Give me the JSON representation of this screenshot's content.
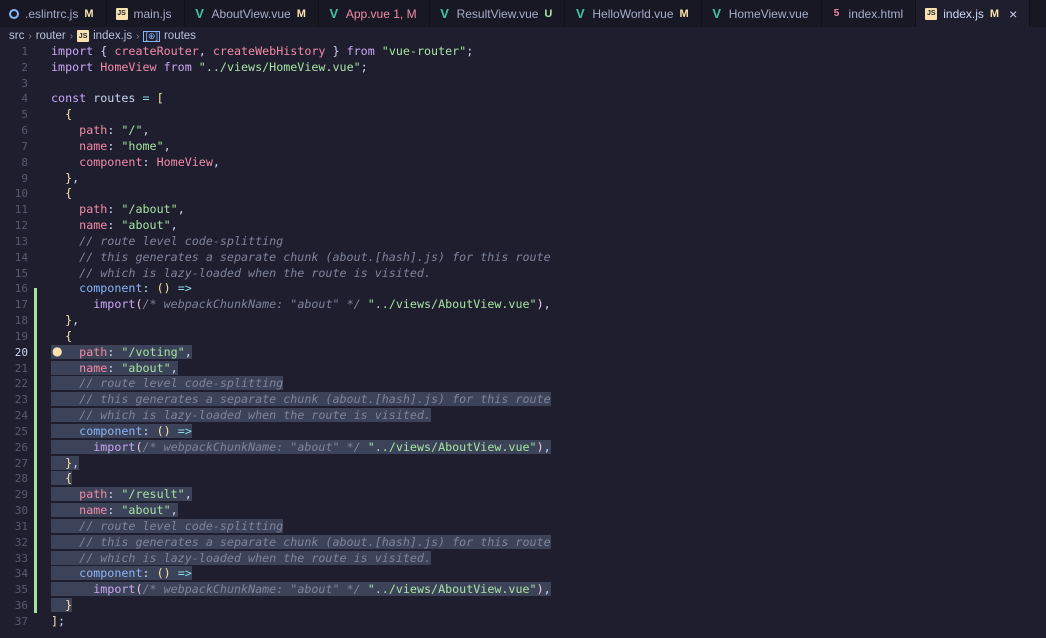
{
  "tabs": [
    {
      "label": ".eslintrc.js",
      "status": "M",
      "icon": "eslint-icon",
      "active": false
    },
    {
      "label": "main.js",
      "status": "",
      "icon": "js-icon",
      "active": false
    },
    {
      "label": "AboutView.vue",
      "status": "M",
      "icon": "vue-icon",
      "active": false
    },
    {
      "label": "App.vue 1, M",
      "status": "",
      "icon": "vue-icon",
      "active": false
    },
    {
      "label": "ResultView.vue",
      "status": "U",
      "icon": "vue-icon",
      "active": false
    },
    {
      "label": "HelloWorld.vue",
      "status": "M",
      "icon": "vue-icon",
      "active": false
    },
    {
      "label": "HomeView.vue",
      "status": "",
      "icon": "vue-icon",
      "active": false
    },
    {
      "label": "index.html",
      "status": "",
      "icon": "html-icon",
      "active": false
    },
    {
      "label": "index.js",
      "status": "M",
      "icon": "js-icon",
      "active": true
    }
  ],
  "breadcrumb": {
    "seg1": "src",
    "seg2": "router",
    "seg3": "index.js",
    "seg4": "routes"
  },
  "icon_glyphs": {
    "js": "JS",
    "vue": "V",
    "close": "×",
    "sym": "[⊕]"
  },
  "colors": {
    "accent_modified": "#f9e2af",
    "accent_untracked": "#a6e3a1",
    "gutter_added": "#a6e3a1"
  },
  "current_line": 20,
  "lines": [
    {
      "n": "1",
      "t": [
        [
          "k",
          "import "
        ],
        [
          "",
          "{ "
        ],
        [
          "p",
          "createRouter"
        ],
        [
          "",
          ", "
        ],
        [
          "p",
          "createWebHistory"
        ],
        [
          "",
          " } "
        ],
        [
          "k",
          "from "
        ],
        [
          "s",
          "\"vue-router\""
        ],
        [
          "",
          ";"
        ]
      ]
    },
    {
      "n": "2",
      "t": [
        [
          "k",
          "import "
        ],
        [
          "p",
          "HomeView "
        ],
        [
          "k",
          "from "
        ],
        [
          "s",
          "\"../views/HomeView.vue\""
        ],
        [
          "",
          ";"
        ]
      ]
    },
    {
      "n": "3",
      "t": []
    },
    {
      "n": "4",
      "t": [
        [
          "k",
          "const "
        ],
        [
          "",
          "routes "
        ],
        [
          "o",
          "= "
        ],
        [
          "b",
          "["
        ]
      ]
    },
    {
      "n": "5",
      "t": [
        [
          "",
          "  "
        ],
        [
          "b",
          "{"
        ]
      ]
    },
    {
      "n": "6",
      "t": [
        [
          "",
          "    "
        ],
        [
          "p",
          "path"
        ],
        [
          "",
          ": "
        ],
        [
          "s",
          "\"/\""
        ],
        [
          "",
          ","
        ]
      ]
    },
    {
      "n": "7",
      "t": [
        [
          "",
          "    "
        ],
        [
          "p",
          "name"
        ],
        [
          "",
          ": "
        ],
        [
          "s",
          "\"home\""
        ],
        [
          "",
          ","
        ]
      ]
    },
    {
      "n": "8",
      "t": [
        [
          "",
          "    "
        ],
        [
          "p",
          "component"
        ],
        [
          "",
          ": "
        ],
        [
          "p",
          "HomeView"
        ],
        [
          "",
          ","
        ]
      ]
    },
    {
      "n": "9",
      "t": [
        [
          "",
          "  "
        ],
        [
          "b",
          "}"
        ],
        [
          "",
          ","
        ]
      ]
    },
    {
      "n": "10",
      "t": [
        [
          "",
          "  "
        ],
        [
          "b",
          "{"
        ]
      ]
    },
    {
      "n": "11",
      "t": [
        [
          "",
          "    "
        ],
        [
          "p",
          "path"
        ],
        [
          "",
          ": "
        ],
        [
          "s",
          "\"/about\""
        ],
        [
          "",
          ","
        ]
      ]
    },
    {
      "n": "12",
      "t": [
        [
          "",
          "    "
        ],
        [
          "p",
          "name"
        ],
        [
          "",
          ": "
        ],
        [
          "s",
          "\"about\""
        ],
        [
          "",
          ","
        ]
      ]
    },
    {
      "n": "13",
      "t": [
        [
          "",
          "    "
        ],
        [
          "c",
          "// route level code-splitting"
        ]
      ]
    },
    {
      "n": "14",
      "t": [
        [
          "",
          "    "
        ],
        [
          "c",
          "// this generates a separate chunk (about.[hash].js) for this route"
        ]
      ]
    },
    {
      "n": "15",
      "t": [
        [
          "",
          "    "
        ],
        [
          "c",
          "// which is lazy-loaded when the route is visited."
        ]
      ]
    },
    {
      "n": "16",
      "t": [
        [
          "",
          "    "
        ],
        [
          "fn",
          "component"
        ],
        [
          "",
          ": "
        ],
        [
          "b",
          "()"
        ],
        [
          "",
          " "
        ],
        [
          "o",
          "=>"
        ]
      ]
    },
    {
      "n": "17",
      "t": [
        [
          "",
          "      "
        ],
        [
          "k",
          "import"
        ],
        [
          "f",
          "("
        ],
        [
          "c",
          "/* webpackChunkName: \"about\" */"
        ],
        [
          "",
          " "
        ],
        [
          "s",
          "\"../views/AboutView.vue\""
        ],
        [
          "f",
          ")"
        ],
        [
          "",
          ","
        ]
      ]
    },
    {
      "n": "18",
      "t": [
        [
          "",
          "  "
        ],
        [
          "b",
          "}"
        ],
        [
          "",
          ","
        ]
      ]
    },
    {
      "n": "19",
      "t": [
        [
          "",
          "  "
        ],
        [
          "b",
          "{"
        ]
      ]
    },
    {
      "n": "20",
      "t": [
        [
          "",
          "    "
        ],
        [
          "p",
          "path"
        ],
        [
          "",
          ": "
        ],
        [
          "s",
          "\"/voting\""
        ],
        [
          "",
          ","
        ]
      ]
    },
    {
      "n": "21",
      "t": [
        [
          "",
          "    "
        ],
        [
          "p",
          "name"
        ],
        [
          "",
          ": "
        ],
        [
          "s",
          "\"about\""
        ],
        [
          "",
          ","
        ]
      ]
    },
    {
      "n": "22",
      "t": [
        [
          "",
          "    "
        ],
        [
          "c",
          "// route level code-splitting"
        ]
      ]
    },
    {
      "n": "23",
      "t": [
        [
          "",
          "    "
        ],
        [
          "c",
          "// this generates a separate chunk (about.[hash].js) for this route"
        ]
      ]
    },
    {
      "n": "24",
      "t": [
        [
          "",
          "    "
        ],
        [
          "c",
          "// which is lazy-loaded when the route is visited."
        ]
      ]
    },
    {
      "n": "25",
      "t": [
        [
          "",
          "    "
        ],
        [
          "fn",
          "component"
        ],
        [
          "",
          ": "
        ],
        [
          "b",
          "()"
        ],
        [
          "",
          " "
        ],
        [
          "o",
          "=>"
        ]
      ]
    },
    {
      "n": "26",
      "t": [
        [
          "",
          "      "
        ],
        [
          "k",
          "import"
        ],
        [
          "f",
          "("
        ],
        [
          "c",
          "/* webpackChunkName: \"about\" */"
        ],
        [
          "",
          " "
        ],
        [
          "s",
          "\"../views/AboutView.vue\""
        ],
        [
          "f",
          ")"
        ],
        [
          "",
          ","
        ]
      ]
    },
    {
      "n": "27",
      "t": [
        [
          "",
          "  "
        ],
        [
          "b",
          "}"
        ],
        [
          "",
          ","
        ]
      ]
    },
    {
      "n": "28",
      "t": [
        [
          "",
          "  "
        ],
        [
          "b",
          "{"
        ]
      ]
    },
    {
      "n": "29",
      "t": [
        [
          "",
          "    "
        ],
        [
          "p",
          "path"
        ],
        [
          "",
          ": "
        ],
        [
          "s",
          "\"/result\""
        ],
        [
          "",
          ","
        ]
      ]
    },
    {
      "n": "30",
      "t": [
        [
          "",
          "    "
        ],
        [
          "p",
          "name"
        ],
        [
          "",
          ": "
        ],
        [
          "s",
          "\"about\""
        ],
        [
          "",
          ","
        ]
      ]
    },
    {
      "n": "31",
      "t": [
        [
          "",
          "    "
        ],
        [
          "c",
          "// route level code-splitting"
        ]
      ]
    },
    {
      "n": "32",
      "t": [
        [
          "",
          "    "
        ],
        [
          "c",
          "// this generates a separate chunk (about.[hash].js) for this route"
        ]
      ]
    },
    {
      "n": "33",
      "t": [
        [
          "",
          "    "
        ],
        [
          "c",
          "// which is lazy-loaded when the route is visited."
        ]
      ]
    },
    {
      "n": "34",
      "t": [
        [
          "",
          "    "
        ],
        [
          "fn",
          "component"
        ],
        [
          "",
          ": "
        ],
        [
          "b",
          "()"
        ],
        [
          "",
          " "
        ],
        [
          "o",
          "=>"
        ]
      ]
    },
    {
      "n": "35",
      "t": [
        [
          "",
          "      "
        ],
        [
          "k",
          "import"
        ],
        [
          "f",
          "("
        ],
        [
          "c",
          "/* webpackChunkName: \"about\" */"
        ],
        [
          "",
          " "
        ],
        [
          "s",
          "\"../views/AboutView.vue\""
        ],
        [
          "f",
          ")"
        ],
        [
          "",
          ","
        ]
      ]
    },
    {
      "n": "36",
      "t": [
        [
          "",
          "  "
        ],
        [
          "b",
          "}"
        ]
      ]
    },
    {
      "n": "37",
      "t": [
        [
          "b",
          "]"
        ],
        [
          "",
          ";"
        ]
      ]
    }
  ],
  "selection": {
    "from_line": 20,
    "to_line": 36
  }
}
